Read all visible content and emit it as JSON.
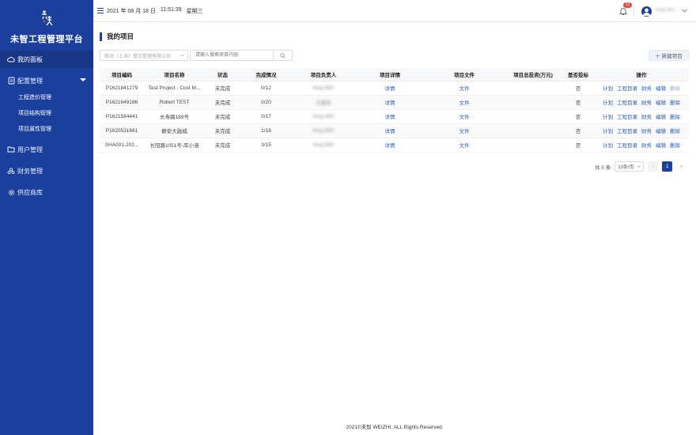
{
  "sidebar": {
    "brand": "未智工程管理平台",
    "items": [
      {
        "label": "我的面板",
        "icon": "cloud-icon"
      },
      {
        "label": "配置管理",
        "icon": "document-icon"
      },
      {
        "label": "用户管理",
        "icon": "folder-icon"
      },
      {
        "label": "财务管理",
        "icon": "people-icon"
      },
      {
        "label": "供应商库",
        "icon": "gear-icon"
      }
    ],
    "sub_items": [
      "工程造价管理",
      "项目结构管理",
      "项目属性管理"
    ]
  },
  "topbar": {
    "date": "2021 年 08 月 18 日",
    "time": "11:51:39",
    "weekday": "星期三",
    "badge_count": "12",
    "username": "King WEI"
  },
  "main": {
    "title": "我的项目",
    "company_select": "移动（上海）餐饮管理有限公司",
    "search_placeholder": "请输入搜索项目内容",
    "new_button": "＋ 新建项目"
  },
  "table": {
    "columns": [
      "项目编码",
      "项目名称",
      "状态",
      "完成情况",
      "项目负责人",
      "项目详情",
      "项目文件",
      "项目总投资(万元)",
      "是否投标",
      "操作"
    ],
    "rows": [
      {
        "code": "P1621841279",
        "name": "Test Project - Cost M...",
        "status": "未完成",
        "progress": "0/12",
        "owner": "King WEI",
        "detail": "详情",
        "file": "文件",
        "investment": "",
        "bid": "否"
      },
      {
        "code": "P1621649186",
        "name": "Robert TEST",
        "status": "未完成",
        "progress": "0/20",
        "owner": "王建军",
        "detail": "详情",
        "file": "文件",
        "investment": "",
        "bid": "否"
      },
      {
        "code": "P1621584441",
        "name": "长寿路189号",
        "status": "未完成",
        "progress": "0/17",
        "owner": "King WEI",
        "detail": "详情",
        "file": "文件",
        "investment": "",
        "bid": "否"
      },
      {
        "code": "P1620531661",
        "name": "静安大融城",
        "status": "未完成",
        "progress": "1/16",
        "owner": "King WEI",
        "detail": "详情",
        "file": "文件",
        "investment": "",
        "bid": "否"
      },
      {
        "code": "SHA001-202...",
        "name": "长阳路1051号-库小涵",
        "status": "未完成",
        "progress": "3/15",
        "owner": "King WEI",
        "detail": "详情",
        "file": "文件",
        "investment": "",
        "bid": "否"
      }
    ],
    "actions": [
      "计划",
      "工程目录",
      "财务",
      "编辑",
      "删除"
    ]
  },
  "pagination": {
    "total": "共 5 条",
    "page_size": "10条/页",
    "prev": "‹",
    "current": "1",
    "next": "›"
  },
  "footer": "2021©未智 WEIZHI. ALL Rights Reserved.",
  "colors": {
    "primary": "#1b3f9c",
    "link": "#2a5ab8",
    "badge": "#e74c3c"
  }
}
